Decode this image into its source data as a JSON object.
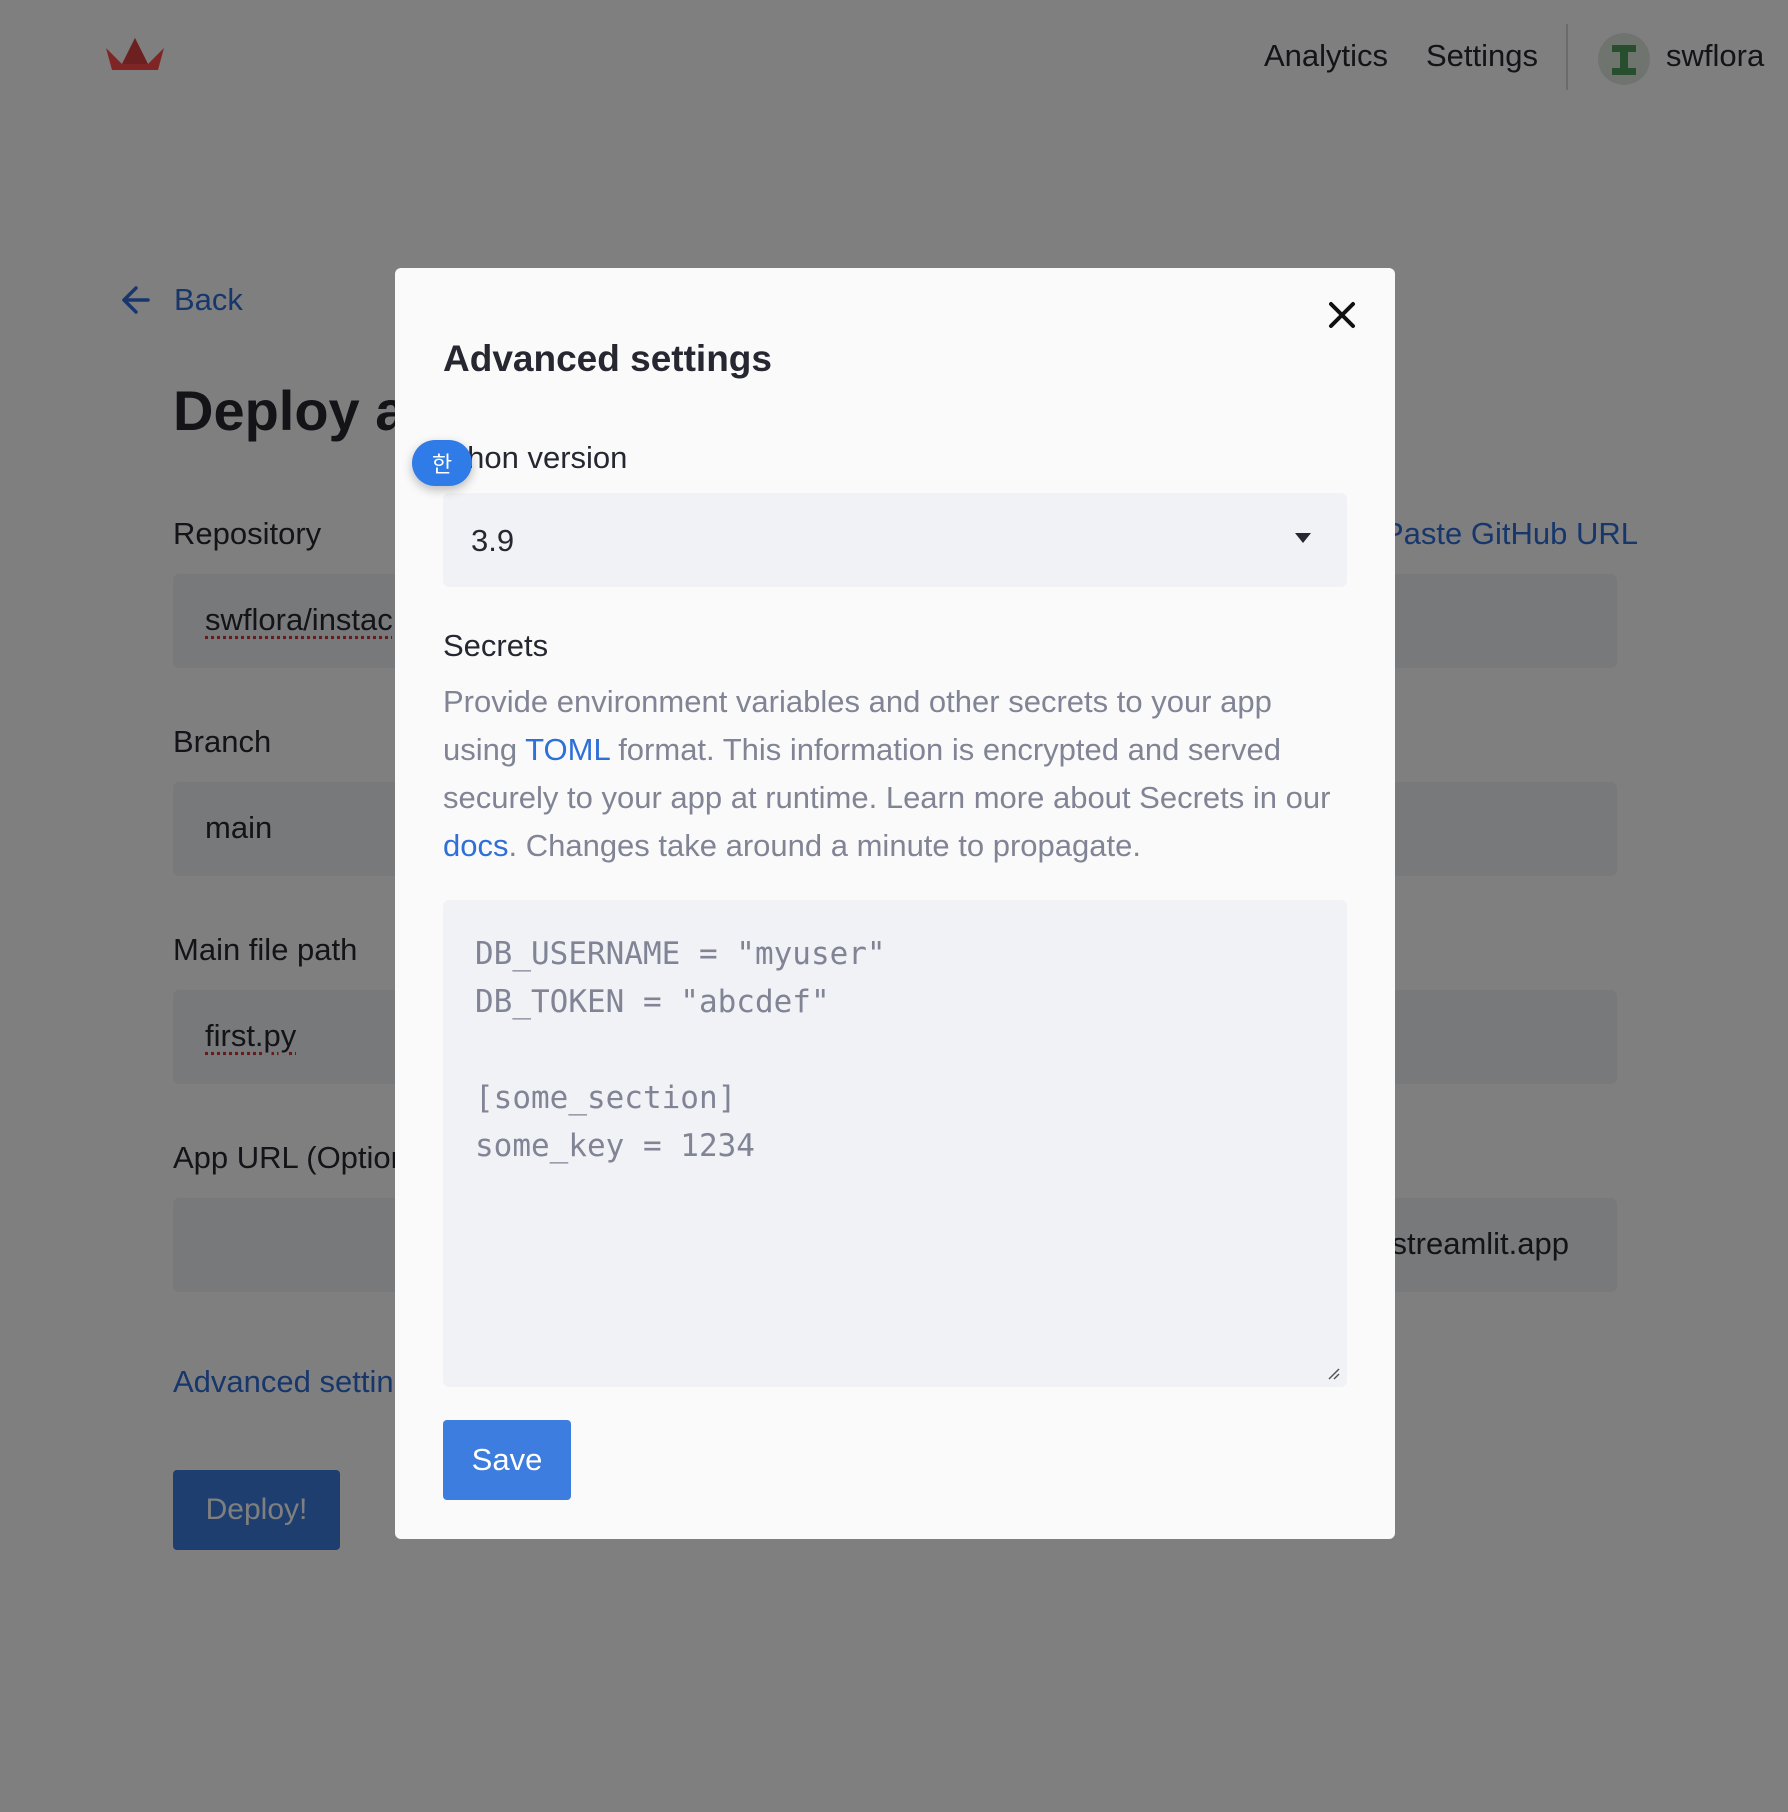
{
  "header": {
    "nav": [
      "Analytics",
      "Settings"
    ],
    "username": "swflora"
  },
  "page": {
    "back_label": "Back",
    "title": "Deploy a",
    "repository_label": "Repository",
    "repository_value": "swflora/instac",
    "paste_github_label": "Paste GitHub URL",
    "branch_label": "Branch",
    "branch_value": "main",
    "main_file_label": "Main file path",
    "main_file_value": "first.py",
    "app_url_label": "App URL (Option",
    "app_url_suffix": "streamlit.app",
    "advanced_link": "Advanced setting",
    "deploy_label": "Deploy!"
  },
  "modal": {
    "title": "Advanced settings",
    "python_label": "ython version",
    "python_value": "3.9",
    "secrets_label": "Secrets",
    "desc_part1": "Provide environment variables and other secrets to your app using ",
    "toml_link": "TOML",
    "desc_part2": " format. This information is encrypted and served securely to your app at runtime. Learn more about Secrets in our ",
    "docs_link": "docs",
    "desc_part3": ". Changes take around a minute to propagate.",
    "secrets_placeholder": "DB_USERNAME = \"myuser\"\nDB_TOKEN = \"abcdef\"\n\n[some_section]\nsome_key = 1234",
    "save_label": "Save"
  },
  "ime_badge": "한",
  "colors": {
    "accent": "#3d7de0",
    "link": "#2e6fd8",
    "logo": "#ff4b4b",
    "input_bg": "#f0f2f6",
    "modal_bg": "#fafafa"
  },
  "icons": {
    "logo": "streamlit-crown-icon",
    "back": "arrow-left-icon",
    "close": "close-icon",
    "caret": "caret-down-icon",
    "resize": "resize-handle-icon",
    "avatar": "avatar-icon"
  }
}
